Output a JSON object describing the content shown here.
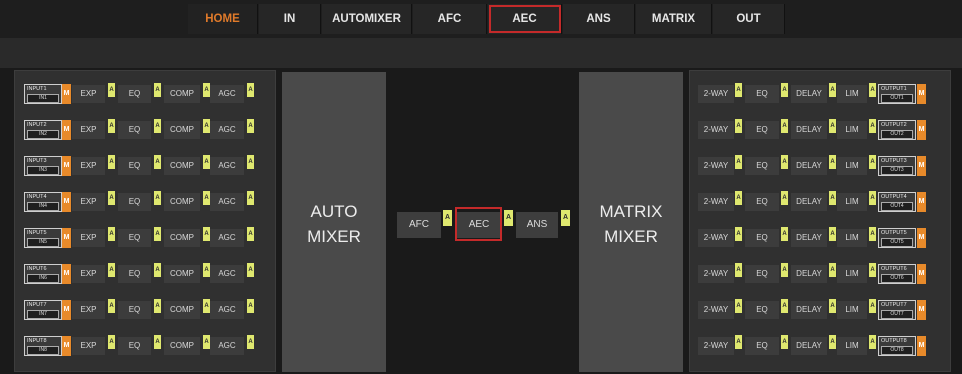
{
  "nav": {
    "tabs": [
      "HOME",
      "IN",
      "AUTOMIXER",
      "AFC",
      "AEC",
      "ANS",
      "MATRIX",
      "OUT"
    ],
    "active": "HOME",
    "highlighted": "AEC"
  },
  "colors": {
    "accent_orange": "#e88a2a",
    "badge_yellow": "#dfe86f",
    "highlight_red": "#c42a2a"
  },
  "input_chain": {
    "mute_label": "M",
    "badge_label": "A",
    "stages": [
      "EXP",
      "EQ",
      "COMP",
      "AGC"
    ],
    "channels": [
      {
        "name": "INPUT1",
        "id": "IN1"
      },
      {
        "name": "INPUT2",
        "id": "IN2"
      },
      {
        "name": "INPUT3",
        "id": "IN3"
      },
      {
        "name": "INPUT4",
        "id": "IN4"
      },
      {
        "name": "INPUT5",
        "id": "IN5"
      },
      {
        "name": "INPUT6",
        "id": "IN6"
      },
      {
        "name": "INPUT7",
        "id": "IN7"
      },
      {
        "name": "INPUT8",
        "id": "IN8"
      }
    ]
  },
  "automixer": {
    "line1": "AUTO",
    "line2": "MIXER"
  },
  "center_chain": {
    "items": [
      "AFC",
      "AEC",
      "ANS"
    ],
    "badge_label": "A",
    "highlighted": "AEC"
  },
  "matrix": {
    "line1": "MATRIX",
    "line2": "MIXER"
  },
  "output_chain": {
    "mute_label": "M",
    "badge_label": "A",
    "stages": [
      "2-WAY",
      "EQ",
      "DELAY",
      "LIM"
    ],
    "channels": [
      {
        "name": "OUTPUT1",
        "id": "OUT1"
      },
      {
        "name": "OUTPUT2",
        "id": "OUT2"
      },
      {
        "name": "OUTPUT3",
        "id": "OUT3"
      },
      {
        "name": "OUTPUT4",
        "id": "OUT4"
      },
      {
        "name": "OUTPUT5",
        "id": "OUT5"
      },
      {
        "name": "OUTPUT6",
        "id": "OUT6"
      },
      {
        "name": "OUTPUT7",
        "id": "OUT7"
      },
      {
        "name": "OUTPUT8",
        "id": "OUT8"
      }
    ]
  }
}
